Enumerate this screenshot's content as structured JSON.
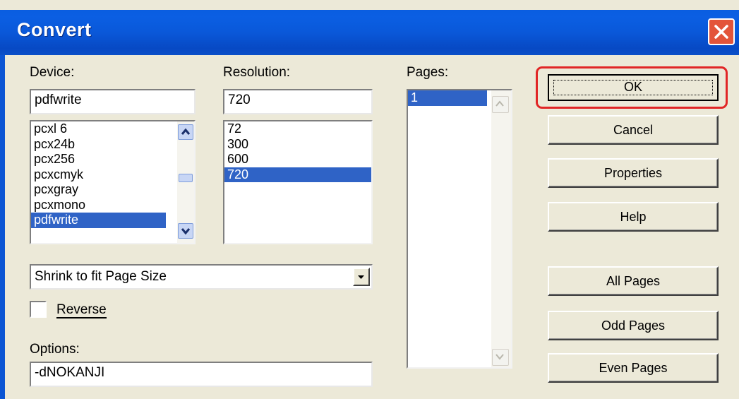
{
  "window": {
    "title": "Convert",
    "accent_color": "#0a58d9",
    "close_color": "#e3543a"
  },
  "labels": {
    "device": "Device:",
    "resolution": "Resolution:",
    "pages": "Pages:",
    "options": "Options:"
  },
  "device": {
    "value": "pdfwrite",
    "items": [
      "pcxl 6",
      "pcx24b",
      "pcx256",
      "pcxcmyk",
      "pcxgray",
      "pcxmono",
      "pdfwrite"
    ],
    "selected": "pdfwrite"
  },
  "resolution": {
    "value": "720",
    "items": [
      "72",
      "300",
      "600",
      "720"
    ],
    "selected": "720"
  },
  "pages": {
    "items": [
      "1"
    ],
    "selected": "1"
  },
  "page_size": {
    "selected": "Shrink to fit Page Size"
  },
  "reverse": {
    "label": "Reverse",
    "checked": false
  },
  "options": {
    "value": "-dNOKANJI"
  },
  "buttons": {
    "ok": "OK",
    "cancel": "Cancel",
    "properties": "Properties",
    "help": "Help",
    "all_pages": "All Pages",
    "odd_pages": "Odd Pages",
    "even_pages": "Even Pages"
  },
  "highlight_color": "#e12626"
}
